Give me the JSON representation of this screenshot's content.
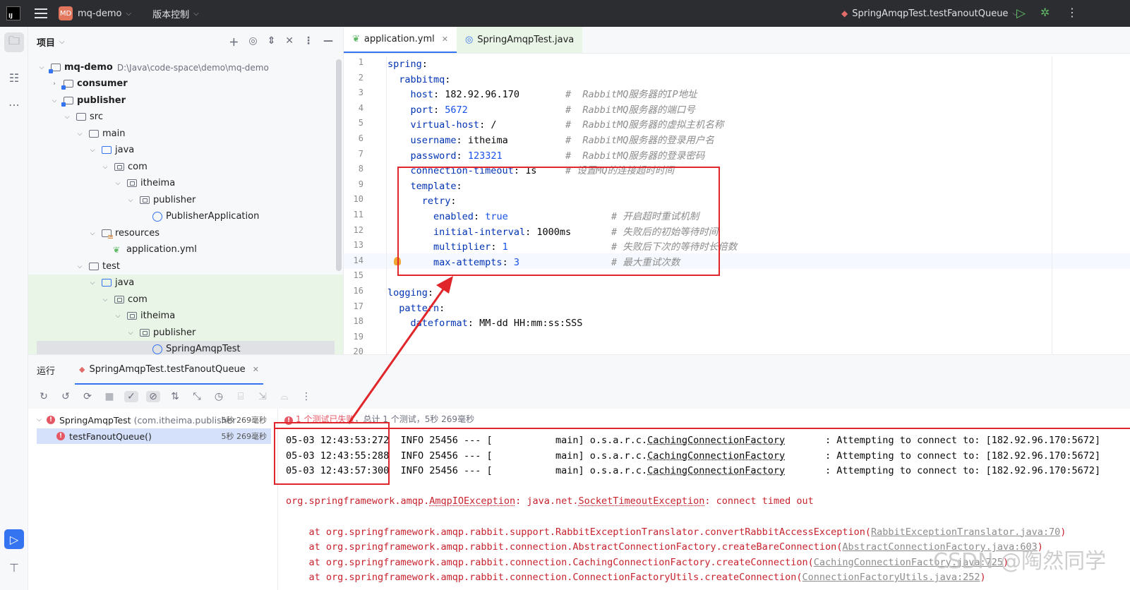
{
  "titlebar": {
    "logo_text": "IJ",
    "project_badge": "MD",
    "project_name": "mq-demo",
    "vcs_label": "版本控制",
    "run_config": "SpringAmqpTest.testFanoutQueue"
  },
  "project_panel": {
    "title": "项目",
    "tree": [
      {
        "label": "mq-demo",
        "path": "D:\\Java\\code-space\\demo\\mq-demo"
      },
      {
        "label": "consumer"
      },
      {
        "label": "publisher"
      },
      {
        "label": "src"
      },
      {
        "label": "main"
      },
      {
        "label": "java"
      },
      {
        "label": "com"
      },
      {
        "label": "itheima"
      },
      {
        "label": "publisher"
      },
      {
        "label": "PublisherApplication"
      },
      {
        "label": "resources"
      },
      {
        "label": "application.yml"
      },
      {
        "label": "test"
      },
      {
        "label": "java"
      },
      {
        "label": "com"
      },
      {
        "label": "itheima"
      },
      {
        "label": "publisher"
      },
      {
        "label": "SpringAmqpTest"
      }
    ]
  },
  "editor": {
    "tabs": [
      {
        "label": "application.yml"
      },
      {
        "label": "SpringAmqpTest.java"
      }
    ],
    "line_numbers": [
      "1",
      "2",
      "3",
      "4",
      "5",
      "6",
      "7",
      "8",
      "9",
      "10",
      "11",
      "12",
      "13",
      "14",
      "15",
      "16",
      "17",
      "18",
      "19",
      "20"
    ],
    "lines": [
      {
        "key": "spring",
        "sep": ":",
        "value": "",
        "comment": ""
      },
      {
        "key": "rabbitmq",
        "sep": ":",
        "value": "",
        "comment": ""
      },
      {
        "key": "host",
        "sep": ": ",
        "value": "182.92.96.170",
        "comment": "#  RabbitMQ服务器的IP地址"
      },
      {
        "key": "port",
        "sep": ": ",
        "value": "5672",
        "comment": "#  RabbitMQ服务器的端口号"
      },
      {
        "key": "virtual-host",
        "sep": ": ",
        "value": "/",
        "comment": "#  RabbitMQ服务器的虚拟主机名称"
      },
      {
        "key": "username",
        "sep": ": ",
        "value": "itheima",
        "comment": "#  RabbitMQ服务器的登录用户名"
      },
      {
        "key": "password",
        "sep": ": ",
        "value": "123321",
        "comment": "#  RabbitMQ服务器的登录密码"
      },
      {
        "key": "connection-timeout",
        "sep": ": ",
        "value": "1s",
        "comment": "# 设置MQ的连接超时时间"
      },
      {
        "key": "template",
        "sep": ":",
        "value": "",
        "comment": ""
      },
      {
        "key": "retry",
        "sep": ":",
        "value": "",
        "comment": ""
      },
      {
        "key": "enabled",
        "sep": ": ",
        "value": "true",
        "comment": "# 开启超时重试机制"
      },
      {
        "key": "initial-interval",
        "sep": ": ",
        "value": "1000ms",
        "comment": "# 失败后的初始等待时间"
      },
      {
        "key": "multiplier",
        "sep": ": ",
        "value": "1",
        "comment": "# 失败后下次的等待时长倍数"
      },
      {
        "key": "max-attempts",
        "sep": ": ",
        "value": "3",
        "comment": "# 最大重试次数"
      },
      {
        "key": "",
        "sep": "",
        "value": "",
        "comment": ""
      },
      {
        "key": "logging",
        "sep": ":",
        "value": "",
        "comment": ""
      },
      {
        "key": "pattern",
        "sep": ":",
        "value": "",
        "comment": ""
      },
      {
        "key": "dateformat",
        "sep": ": ",
        "value": "MM-dd HH:mm:ss:SSS",
        "comment": ""
      },
      {
        "key": "",
        "sep": "",
        "value": "",
        "comment": ""
      },
      {
        "key": "",
        "sep": "",
        "value": "",
        "comment": ""
      }
    ]
  },
  "run_panel": {
    "title": "运行",
    "tab_label": "SpringAmqpTest.testFanoutQueue",
    "tests": [
      {
        "name": "SpringAmqpTest",
        "pkg": "(com.itheima.publisher",
        "time": "5秒 269毫秒"
      },
      {
        "name": "testFanoutQueue()",
        "pkg": "",
        "time": "5秒 269毫秒"
      }
    ],
    "status_fail": "1 个测试已失败",
    "status_total": "，总计 1 个测试，5秒 269毫秒",
    "log_lines": [
      {
        "ts": "05-03 12:43:53:272",
        "mid": "  INFO 25456 --- [           main] o.s.a.r.c.",
        "cls": "CachingConnectionFactory",
        "msg": "       : Attempting to connect to: [182.92.96.170:5672]"
      },
      {
        "ts": "05-03 12:43:55:288",
        "mid": "  INFO 25456 --- [           main] o.s.a.r.c.",
        "cls": "CachingConnectionFactory",
        "msg": "       : Attempting to connect to: [182.92.96.170:5672]"
      },
      {
        "ts": "05-03 12:43:57:300",
        "mid": "  INFO 25456 --- [           main] o.s.a.r.c.",
        "cls": "CachingConnectionFactory",
        "msg": "       : Attempting to connect to: [182.92.96.170:5672]"
      }
    ],
    "exception": {
      "prefix": "org.springframework.amqp.",
      "ex1": "AmqpIOException",
      "mid": ": java.net.",
      "ex2": "SocketTimeoutException",
      "msg": ": connect timed out"
    },
    "stack": [
      {
        "text": "    at org.springframework.amqp.rabbit.support.RabbitExceptionTranslator.convertRabbitAccessException(",
        "link": "RabbitExceptionTranslator.java:70",
        "end": ")"
      },
      {
        "text": "    at org.springframework.amqp.rabbit.connection.AbstractConnectionFactory.createBareConnection(",
        "link": "AbstractConnectionFactory.java:603",
        "end": ")"
      },
      {
        "text": "    at org.springframework.amqp.rabbit.connection.CachingConnectionFactory.createConnection(",
        "link": "CachingConnectionFactory.java:725",
        "end": ")"
      },
      {
        "text": "    at org.springframework.amqp.rabbit.connection.ConnectionFactoryUtils.createConnection(",
        "link": "ConnectionFactoryUtils.java:252",
        "end": ")"
      }
    ]
  },
  "watermark": "CSDN @陶然同学"
}
